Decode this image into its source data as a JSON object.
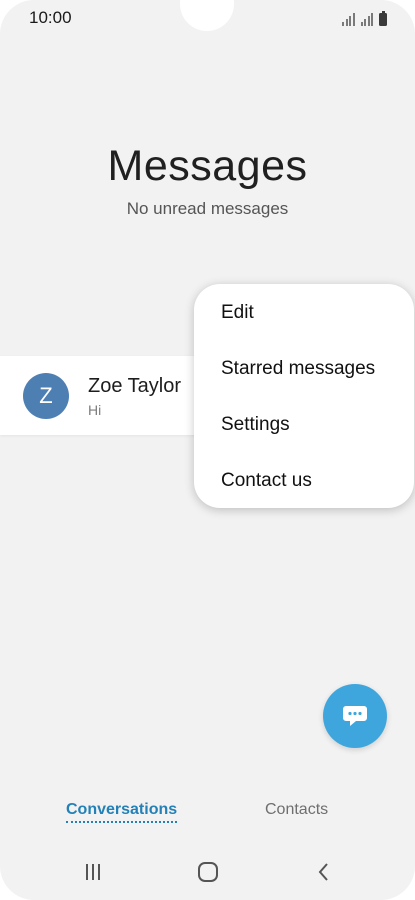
{
  "status_bar": {
    "time": "10:00",
    "signal_icon": "signal-bars-icon",
    "battery_icon": "battery-icon"
  },
  "header": {
    "title": "Messages",
    "subtitle": "No unread messages"
  },
  "conversation": {
    "avatar_letter": "Z",
    "avatar_color": "#4e7fb3",
    "contact_name": "Zoe Taylor",
    "last_message": "Hi"
  },
  "menu": {
    "items": [
      {
        "label": "Edit"
      },
      {
        "label": "Starred messages"
      },
      {
        "label": "Settings"
      },
      {
        "label": "Contact us"
      }
    ]
  },
  "fab": {
    "icon": "compose-message-icon",
    "color": "#3fa6dd"
  },
  "tabs": {
    "active": "Conversations",
    "inactive": "Contacts",
    "accent_color": "#2481b7"
  },
  "nav": {
    "recent_icon": "recent-apps-icon",
    "home_icon": "home-icon",
    "back_icon": "back-icon"
  }
}
